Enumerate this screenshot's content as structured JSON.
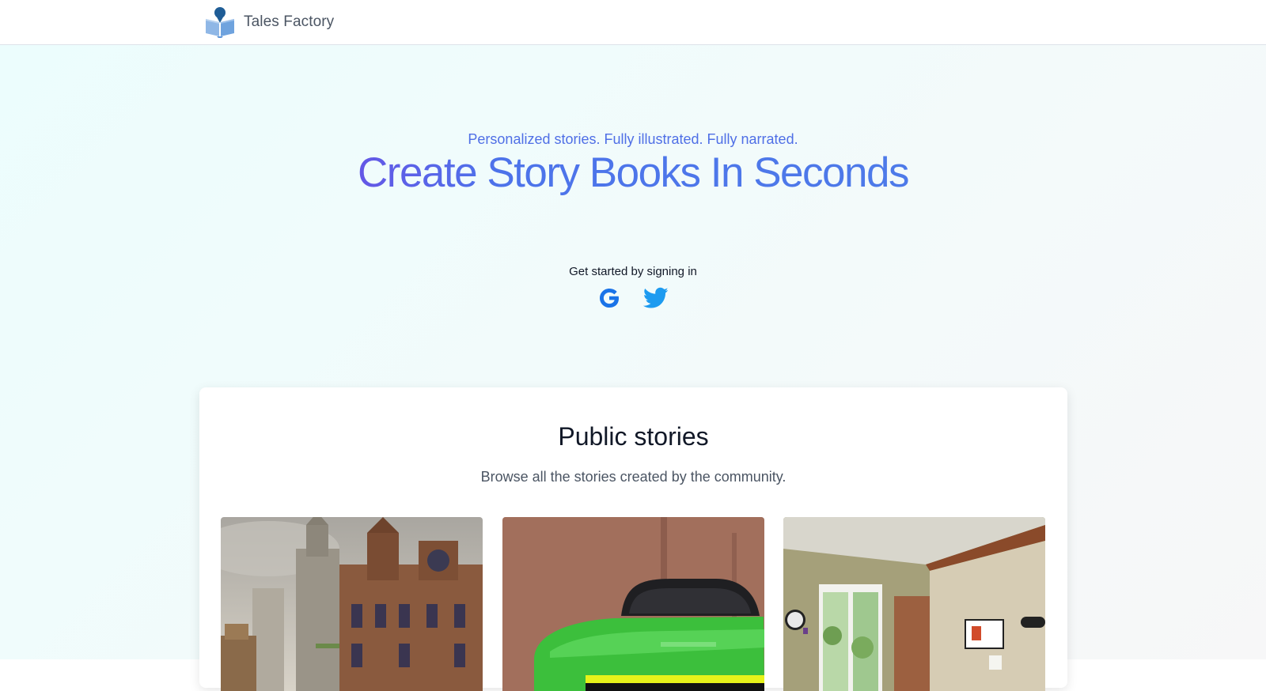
{
  "brand": {
    "name": "Tales Factory",
    "logo_icon": "book-pin-icon"
  },
  "hero": {
    "tagline": "Personalized stories. Fully illustrated. Fully narrated.",
    "headline": "Create Story Books In Seconds",
    "signin_label": "Get started by signing in",
    "providers": [
      {
        "name": "Google",
        "icon": "google-icon",
        "color": "#1a73e8"
      },
      {
        "name": "Twitter",
        "icon": "twitter-icon",
        "color": "#1d9bf0"
      }
    ]
  },
  "public_stories": {
    "title": "Public stories",
    "subtitle": "Browse all the stories created by the community.",
    "items": [
      {
        "image": "steampunk-city-illustration"
      },
      {
        "image": "green-car-illustration"
      },
      {
        "image": "office-room-illustration"
      }
    ]
  },
  "colors": {
    "accent": "#4f6fe6",
    "gradient_start": "#6457e6",
    "gradient_end": "#4d7ae9"
  }
}
